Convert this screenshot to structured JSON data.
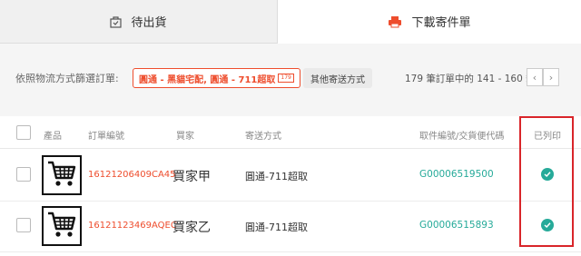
{
  "tabs": {
    "pending_label": "待出貨",
    "download_label": "下載寄件單"
  },
  "filter": {
    "label": "依照物流方式篩選訂單:",
    "selected_chip": "圓通 - 黑貓宅配, 圓通 - 711超取",
    "selected_count": "179",
    "other_chip": "其他寄送方式",
    "pager_text": "179 筆訂單中的 141 - 160 筆",
    "prev_icon": "chevron-left-icon",
    "next_icon": "chevron-right-icon"
  },
  "table": {
    "headers": {
      "product": "產品",
      "order_id": "訂單編號",
      "buyer": "買家",
      "shipping": "寄送方式",
      "tracking": "取件編號/交貨便代碼",
      "printed": "已列印"
    },
    "rows": [
      {
        "thumbnail_icon": "shopping-cart-icon",
        "order_id": "16121206409CA45",
        "buyer": "買家甲",
        "shipping": "圓通-711超取",
        "tracking": "G00006519500",
        "printed_icon": "check-circle-icon"
      },
      {
        "thumbnail_icon": "shopping-cart-icon",
        "order_id": "16121123469AQEC",
        "buyer": "買家乙",
        "shipping": "圓通-711超取",
        "tracking": "G00006515893",
        "printed_icon": "check-circle-icon"
      }
    ]
  },
  "colors": {
    "accent": "#ee4d2d",
    "teal": "#26aa99",
    "highlight": "#d9252a"
  }
}
